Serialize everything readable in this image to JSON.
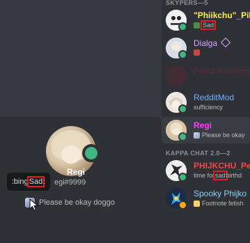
{
  "profile": {
    "name": "Regi",
    "tag": "egi#9999",
    "status_text": "Please be okay doggo",
    "tooltip_prefix": ":bing",
    "tooltip_highlight": "Sad",
    "tooltip_suffix": ":"
  },
  "members": {
    "sections": [
      {
        "title": "SKYPERS—5"
      },
      {
        "title": "KAPPA CHAT 2.0—2"
      }
    ],
    "skypers": [
      {
        "name": "\"Phiikchu\"_Pil",
        "sub_highlight": "Sad",
        "name_color": "#faf04b",
        "status": "online"
      },
      {
        "name": "Dialga",
        "sub": "",
        "name_color": "#d4a5ff",
        "status": "online"
      },
      {
        "name": "Peitat Renofresh",
        "sub": "",
        "name_color": "#8b2a3a",
        "status": "offline"
      },
      {
        "name": "RedditMod",
        "sub": "sufficiency",
        "name_color": "#6fb0ff",
        "status": "online"
      },
      {
        "name": "Regi",
        "sub": "Please be okay",
        "name_color": "#ff3df2",
        "status": "online"
      }
    ],
    "kappa": [
      {
        "name": "PHIJKCHU_Pe",
        "sub_prefix": "time for ",
        "sub_highlight": "sad",
        "sub_suffix": " birthd",
        "name_color": "#f04747",
        "status": "online"
      },
      {
        "name": "Spooky Phijko",
        "sub": "Footnote fetish",
        "name_color": "#8ad2ff",
        "status": "idle"
      }
    ]
  },
  "colors": {
    "online": "#43b581",
    "idle": "#faa61a",
    "highlight_box": "#e81c1c",
    "background": "#36393f",
    "sidebar": "#2f3136"
  }
}
